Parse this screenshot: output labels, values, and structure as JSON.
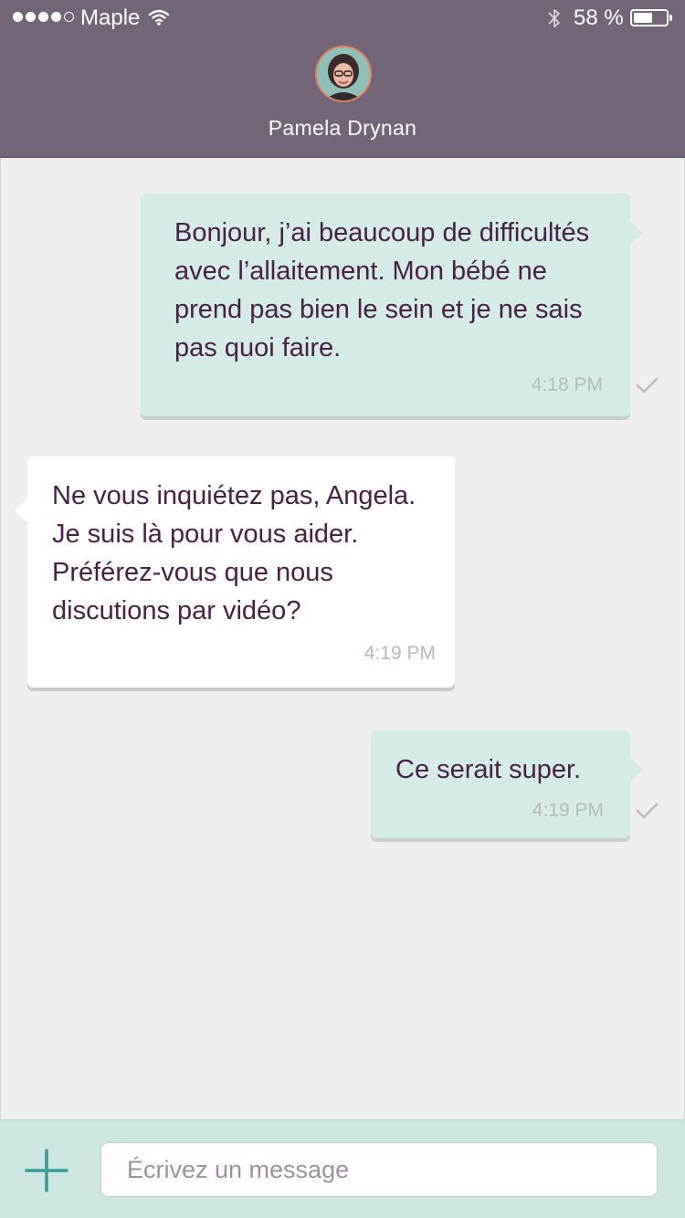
{
  "status_bar": {
    "carrier": "Maple",
    "signal_bars_filled": 4,
    "signal_bars_total": 5,
    "battery_percent_label": "58 %",
    "battery_level": 0.58,
    "icons": [
      "wifi-icon",
      "bluetooth-icon",
      "battery-icon"
    ]
  },
  "header": {
    "contact_name": "Pamela Drynan",
    "avatar_border_color": "#e57f61",
    "background_color": "#726577"
  },
  "messages": [
    {
      "direction": "outgoing",
      "text": "Bonjour, j’ai beaucoup de difficultés avec l’allaitement. Mon bébé ne prend pas bien le sein et je ne sais pas quoi faire.",
      "time": "4:18 PM",
      "read_receipt": "check-icon"
    },
    {
      "direction": "incoming",
      "text": "Ne vous inquiétez pas, Angela. Je suis là pour vous aider. Préférez-vous que nous discutions par vidéo?",
      "time": "4:19 PM"
    },
    {
      "direction": "outgoing",
      "text": "Ce serait super.",
      "time": "4:19 PM",
      "read_receipt": "check-icon"
    }
  ],
  "composer": {
    "placeholder": "Écrivez un message",
    "value": "",
    "add_icon": "plus-icon"
  },
  "colors": {
    "outgoing_bubble": "#d5ebe5",
    "incoming_bubble": "#ffffff",
    "message_text": "#4a2146",
    "accent": "#3a9c95",
    "chat_background": "#efefed"
  }
}
